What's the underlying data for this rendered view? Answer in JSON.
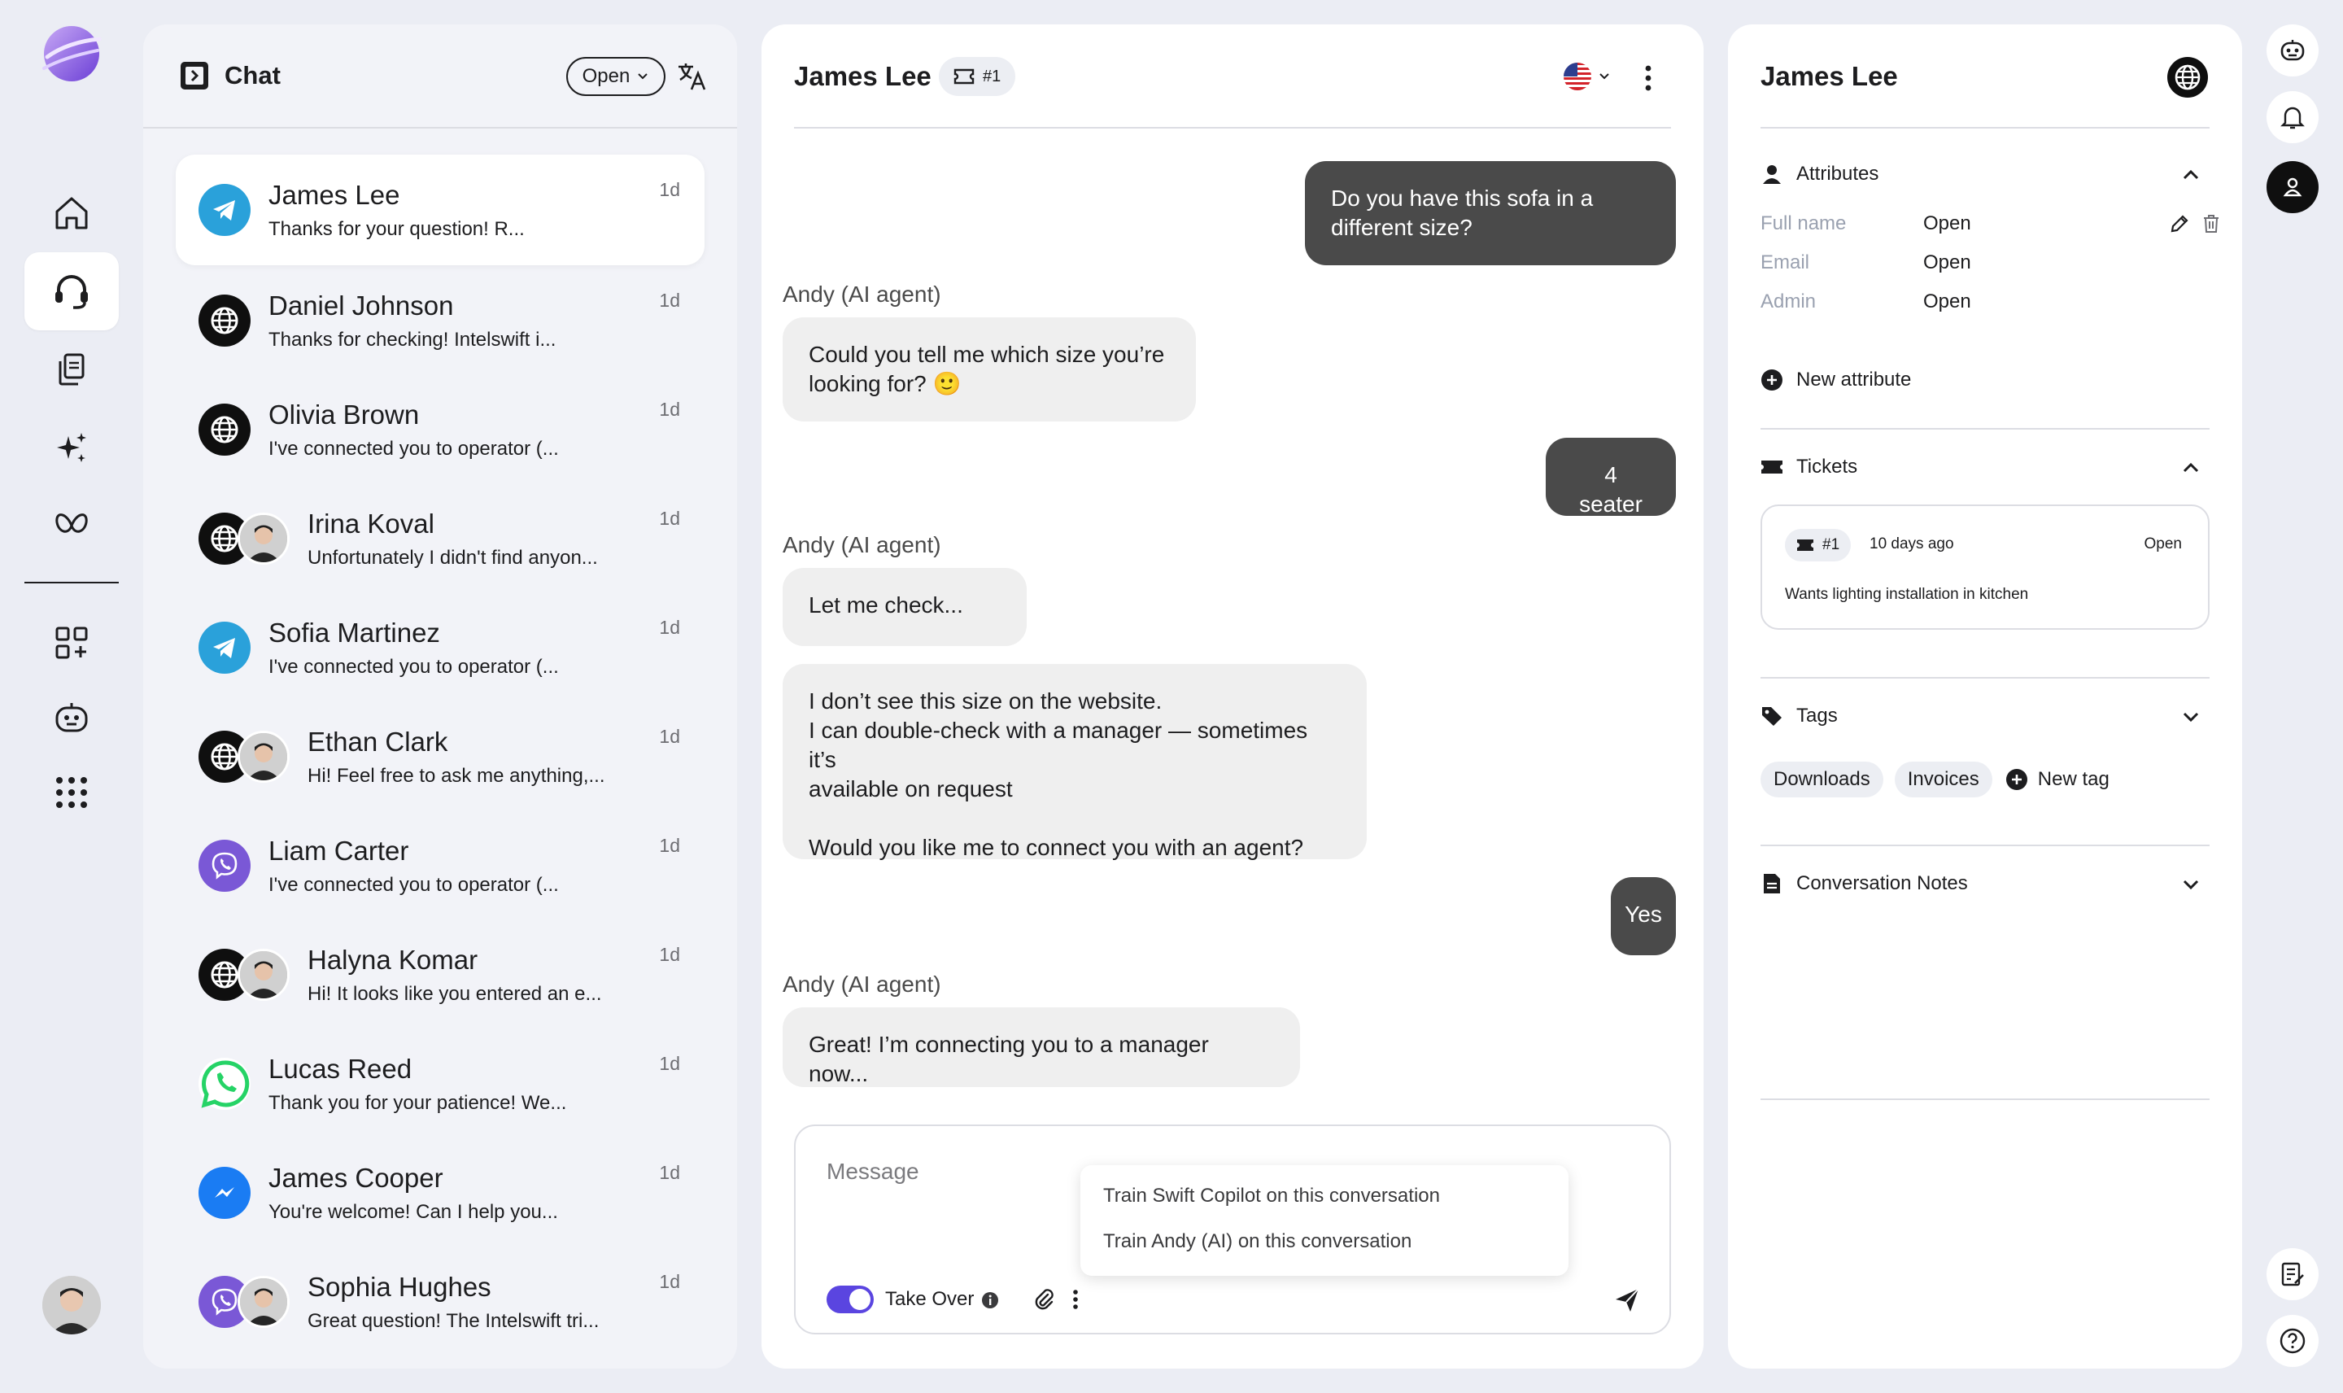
{
  "nav": {
    "items": [
      "home",
      "support",
      "documents",
      "ai-sparkles",
      "workflows",
      "add-apps",
      "bots",
      "apps-grid"
    ],
    "active": "support",
    "accent": "#7a58d6"
  },
  "chats": {
    "title": "Chat",
    "status_filter": "Open",
    "items": [
      {
        "name": "James Lee",
        "preview": "Thanks for your question! R...",
        "time": "1d",
        "channel": "telegram",
        "active": true
      },
      {
        "name": "Daniel Johnson",
        "preview": "Thanks for checking! Intelswift i...",
        "time": "1d",
        "channel": "web"
      },
      {
        "name": "Olivia Brown",
        "preview": "I've connected you to operator  (...",
        "time": "1d",
        "channel": "web"
      },
      {
        "name": "Irina Koval",
        "preview": "Unfortunately I didn't find anyon...",
        "time": "1d",
        "channel": "web",
        "operator": true
      },
      {
        "name": "Sofia Martinez",
        "preview": "I've connected you to operator (...",
        "time": "1d",
        "channel": "telegram"
      },
      {
        "name": "Ethan Clark",
        "preview": "Hi! Feel free to ask me anything,...",
        "time": "1d",
        "channel": "web",
        "operator": true
      },
      {
        "name": "Liam Carter",
        "preview": "I've connected you to operator (...",
        "time": "1d",
        "channel": "viber"
      },
      {
        "name": "Halyna Komar",
        "preview": "Hi! It looks like you entered an e...",
        "time": "1d",
        "channel": "web",
        "operator": true
      },
      {
        "name": "Lucas Reed",
        "preview": "Thank you for your patience! We...",
        "time": "1d",
        "channel": "whatsapp"
      },
      {
        "name": "James Cooper",
        "preview": "You're welcome! Can I help you...",
        "time": "1d",
        "channel": "messenger"
      },
      {
        "name": "Sophia Hughes",
        "preview": "Great question! The Intelswift tri...",
        "time": "1d",
        "channel": "viber",
        "operator": true
      }
    ]
  },
  "conversation": {
    "contact_name": "James Lee",
    "ticket_badge": "#1",
    "language": "en-US",
    "messages": [
      {
        "from": "customer",
        "text": "Do you have this sofa in a\ndifferent size?"
      },
      {
        "from": "agent",
        "author": "Andy (AI agent)",
        "text": "Could you tell me which size you’re\nlooking for? 🙂"
      },
      {
        "from": "customer",
        "text": "4 seater"
      },
      {
        "from": "agent",
        "author": "Andy (AI agent)",
        "text": "Let me check..."
      },
      {
        "from": "agent",
        "text": "I don’t see this size on the website.\nI can double-check with a manager — sometimes it’s\navailable on request\n\nWould you like me to connect you with an agent?"
      },
      {
        "from": "customer",
        "text": "Yes"
      },
      {
        "from": "agent",
        "author": "Andy (AI agent)",
        "text": "Great!  I’m connecting you to a manager now..."
      }
    ],
    "composer": {
      "placeholder": "Message",
      "suggestions": [
        "Train Swift Copilot on this conversation",
        "Train Andy (AI) on this conversation"
      ],
      "take_over_label": "Take Over",
      "take_over_on": true,
      "accent": "#5a45e0"
    }
  },
  "info": {
    "contact_name": "James Lee",
    "attributes": {
      "title": "Attributes",
      "rows": [
        {
          "key": "Full name",
          "value": "Open"
        },
        {
          "key": "Email",
          "value": "Open"
        },
        {
          "key": "Admin",
          "value": "Open"
        }
      ],
      "new_label": "New attribute"
    },
    "tickets": {
      "title": "Tickets",
      "items": [
        {
          "id": "#1",
          "date": "10 days ago",
          "status": "Open",
          "description": "Wants lighting installation in kitchen"
        }
      ]
    },
    "tags": {
      "title": "Tags",
      "items": [
        "Downloads",
        "Invoices"
      ],
      "new_label": "New tag"
    },
    "notes": {
      "title": "Conversation Notes"
    }
  }
}
